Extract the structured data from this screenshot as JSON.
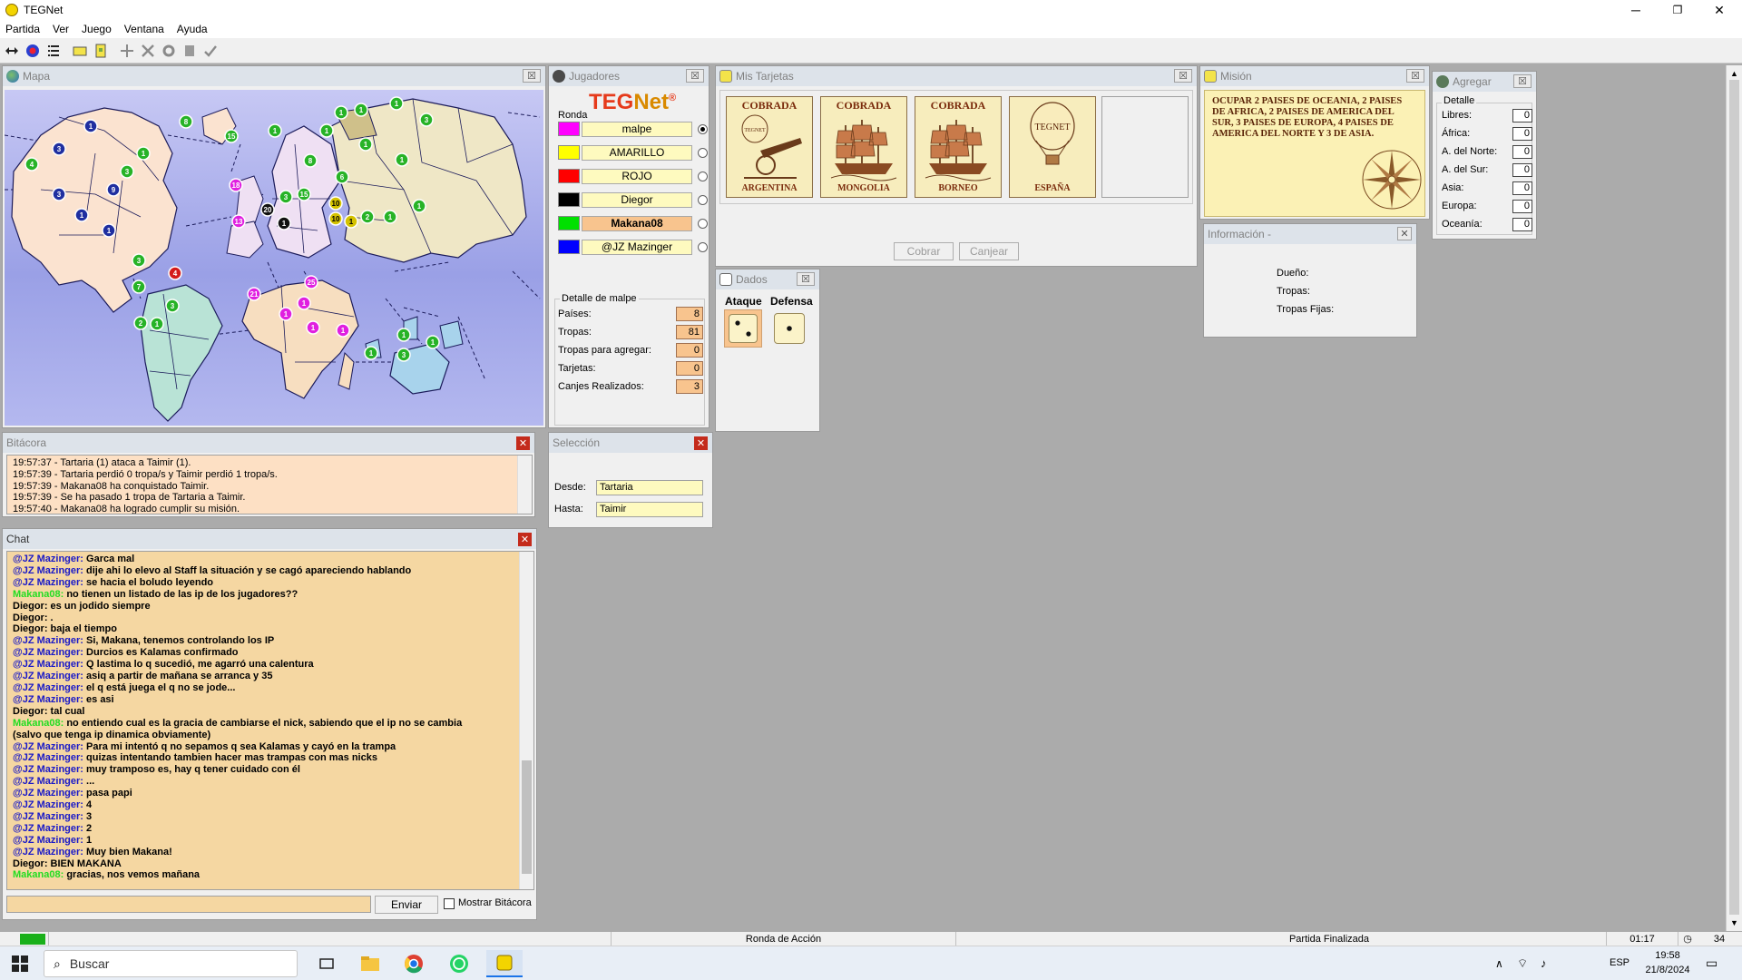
{
  "window": {
    "title": "TEGNet",
    "minimize": "─",
    "maximize": "❐",
    "close": "✕"
  },
  "menu": [
    "Partida",
    "Ver",
    "Juego",
    "Ventana",
    "Ayuda"
  ],
  "map": {
    "title": "Mapa",
    "troops": [
      {
        "n": "1",
        "c": "#1f2fa0"
      },
      {
        "n": "3",
        "c": "#1f2fa0"
      },
      {
        "n": "4",
        "c": "#27b327"
      },
      {
        "n": "3",
        "c": "#1f2fa0"
      },
      {
        "n": "9",
        "c": "#1f2fa0"
      },
      {
        "n": "1",
        "c": "#1f2fa0"
      },
      {
        "n": "1",
        "c": "#1f2fa0"
      },
      {
        "n": "3",
        "c": "#27b327"
      },
      {
        "n": "1",
        "c": "#27b327"
      },
      {
        "n": "8",
        "c": "#27b327"
      },
      {
        "n": "15",
        "c": "#27b327"
      },
      {
        "n": "1",
        "c": "#27b327"
      },
      {
        "n": "18",
        "c": "#e020e0"
      },
      {
        "n": "20",
        "c": "#111111"
      },
      {
        "n": "13",
        "c": "#e020e0"
      },
      {
        "n": "1",
        "c": "#111111"
      },
      {
        "n": "3",
        "c": "#27b327"
      },
      {
        "n": "15",
        "c": "#27b327"
      },
      {
        "n": "8",
        "c": "#27b327"
      },
      {
        "n": "10",
        "c": "#d4c200"
      },
      {
        "n": "10",
        "c": "#d4c200"
      },
      {
        "n": "1",
        "c": "#d4c200"
      },
      {
        "n": "1",
        "c": "#27b327"
      },
      {
        "n": "1",
        "c": "#27b327"
      },
      {
        "n": "1",
        "c": "#27b327"
      },
      {
        "n": "6",
        "c": "#27b327"
      },
      {
        "n": "1",
        "c": "#27b327"
      },
      {
        "n": "1",
        "c": "#27b327"
      },
      {
        "n": "1",
        "c": "#27b327"
      },
      {
        "n": "2",
        "c": "#27b327"
      },
      {
        "n": "1",
        "c": "#27b327"
      },
      {
        "n": "1",
        "c": "#27b327"
      },
      {
        "n": "3",
        "c": "#27b327"
      },
      {
        "n": "1",
        "c": "#27b327"
      },
      {
        "n": "3",
        "c": "#27b327"
      },
      {
        "n": "4",
        "c": "#d41a1a"
      },
      {
        "n": "7",
        "c": "#27b327"
      },
      {
        "n": "3",
        "c": "#27b327"
      },
      {
        "n": "2",
        "c": "#27b327"
      },
      {
        "n": "1",
        "c": "#27b327"
      },
      {
        "n": "21",
        "c": "#e020e0"
      },
      {
        "n": "25",
        "c": "#e020e0"
      },
      {
        "n": "1",
        "c": "#e020e0"
      },
      {
        "n": "1",
        "c": "#e020e0"
      },
      {
        "n": "1",
        "c": "#e020e0"
      },
      {
        "n": "1",
        "c": "#e020e0"
      },
      {
        "n": "1",
        "c": "#27b327"
      },
      {
        "n": "3",
        "c": "#27b327"
      },
      {
        "n": "1",
        "c": "#27b327"
      },
      {
        "n": "1",
        "c": "#27b327"
      }
    ]
  },
  "players": {
    "title": "Jugadores",
    "logo_a": "TEG",
    "logo_b": "Net",
    "logo_mark": "®",
    "round_label": "Ronda",
    "list": [
      {
        "name": "malpe",
        "color": "#ff00ff",
        "selected": true,
        "bold": false
      },
      {
        "name": "AMARILLO",
        "color": "#ffff00",
        "selected": false,
        "bold": false
      },
      {
        "name": "ROJO",
        "color": "#ff0000",
        "selected": false,
        "bold": false
      },
      {
        "name": "Diegor",
        "color": "#000000",
        "selected": false,
        "bold": false
      },
      {
        "name": "Makana08",
        "color": "#00e000",
        "selected": false,
        "bold": true
      },
      {
        "name": "@JZ Mazinger",
        "color": "#0000ff",
        "selected": false,
        "bold": false
      }
    ],
    "detail_title": "Detalle de malpe",
    "detail": [
      {
        "label": "Países:",
        "value": "8"
      },
      {
        "label": "Tropas:",
        "value": "81"
      },
      {
        "label": "Tropas para agregar:",
        "value": "0"
      },
      {
        "label": "Tarjetas:",
        "value": "0"
      },
      {
        "label": "Canjes Realizados:",
        "value": "3"
      }
    ]
  },
  "cards": {
    "title": "Mis Tarjetas",
    "items": [
      {
        "status": "COBRADA",
        "country": "ARGENTINA",
        "symbol": "cannon"
      },
      {
        "status": "COBRADA",
        "country": "MONGOLIA",
        "symbol": "ship"
      },
      {
        "status": "COBRADA",
        "country": "BORNEO",
        "symbol": "ship"
      },
      {
        "status": "",
        "country": "ESPAÑA",
        "symbol": "balloon"
      }
    ],
    "balloon_logo": "TEGNET",
    "cannon_logo": "TEGNET",
    "btn_cobrar": "Cobrar",
    "btn_canjear": "Canjear"
  },
  "mission": {
    "title": "Misión",
    "text": "OCUPAR 2 PAISES DE OCEANIA, 2 PAISES DE AFRICA, 2 PAISES DE AMERICA DEL SUR, 3 PAISES DE EUROPA, 4 PAISES DE AMERICA DEL NORTE Y 3 DE ASIA."
  },
  "agregar": {
    "title": "Agregar",
    "detail_label": "Detalle",
    "rows": [
      {
        "label": "Libres:",
        "value": "0"
      },
      {
        "label": "África:",
        "value": "0"
      },
      {
        "label": "A. del Norte:",
        "value": "0"
      },
      {
        "label": "A. del Sur:",
        "value": "0"
      },
      {
        "label": "Asia:",
        "value": "0"
      },
      {
        "label": "Europa:",
        "value": "0"
      },
      {
        "label": "Oceanía:",
        "value": "0"
      }
    ]
  },
  "info": {
    "title": "Información -",
    "owner": "Dueño:",
    "troops": "Tropas:",
    "fixed": "Tropas Fijas:"
  },
  "dice": {
    "title": "Dados",
    "attack": "Ataque",
    "defense": "Defensa",
    "attack_value": 2,
    "defense_value": 1
  },
  "selection": {
    "title": "Selección",
    "from_label": "Desde:",
    "from": "Tartaria",
    "to_label": "Hasta:",
    "to": "Taimir"
  },
  "log": {
    "title": "Bitácora",
    "lines": [
      "19:57:37 - Tartaria (1) ataca a Taimir (1).",
      "19:57:39 - Tartaria perdió 0 tropa/s y Taimir perdió 1 tropa/s.",
      "19:57:39 - Makana08 ha conquistado Taimir.",
      "19:57:39 - Se ha pasado 1 tropa de Tartaria a Taimir.",
      "19:57:40 - Makana08 ha logrado cumplir su misión."
    ]
  },
  "chat": {
    "title": "Chat",
    "send": "Enviar",
    "show_log": "Mostrar Bitácora",
    "lines": [
      {
        "who": "@JZ Mazinger:",
        "c": "#1a1ac8",
        "msg": " Garca mal"
      },
      {
        "who": "@JZ Mazinger:",
        "c": "#1a1ac8",
        "msg": " dije ahi lo elevo al Staff la situación y se cagó apareciendo hablando"
      },
      {
        "who": "@JZ Mazinger:",
        "c": "#1a1ac8",
        "msg": " se hacia el boludo leyendo"
      },
      {
        "who": "Makana08:",
        "c": "#22dd22",
        "msg": " no tienen un listado de las ip de los jugadores??"
      },
      {
        "who": "Diegor:",
        "c": "#000000",
        "msg": " es un jodido siempre"
      },
      {
        "who": "Diegor:",
        "c": "#000000",
        "msg": " ."
      },
      {
        "who": "Diegor:",
        "c": "#000000",
        "msg": " baja el tiempo"
      },
      {
        "who": "@JZ Mazinger:",
        "c": "#1a1ac8",
        "msg": " Si, Makana, tenemos controlando los IP"
      },
      {
        "who": "@JZ Mazinger:",
        "c": "#1a1ac8",
        "msg": " Durcios es Kalamas confirmado"
      },
      {
        "who": "@JZ Mazinger:",
        "c": "#1a1ac8",
        "msg": " Q lastima lo q sucedió, me agarró una calentura"
      },
      {
        "who": "@JZ Mazinger:",
        "c": "#1a1ac8",
        "msg": " asiq a partir de mañana se arranca y 35"
      },
      {
        "who": "@JZ Mazinger:",
        "c": "#1a1ac8",
        "msg": " el q está juega el q no se jode..."
      },
      {
        "who": "@JZ Mazinger:",
        "c": "#1a1ac8",
        "msg": " es asi"
      },
      {
        "who": "Diegor:",
        "c": "#000000",
        "msg": " tal cual"
      },
      {
        "who": "Makana08:",
        "c": "#22dd22",
        "msg": " no entiendo cual es la gracia de cambiarse el nick, sabiendo que el ip no se cambia"
      },
      {
        "who": "",
        "c": "#000000",
        "msg": "(salvo que tenga ip dinamica obviamente)"
      },
      {
        "who": "@JZ Mazinger:",
        "c": "#1a1ac8",
        "msg": " Para mi intentó q no sepamos q sea Kalamas y cayó en la trampa"
      },
      {
        "who": "@JZ Mazinger:",
        "c": "#1a1ac8",
        "msg": " quizas intentando tambien hacer mas trampas con mas nicks"
      },
      {
        "who": "@JZ Mazinger:",
        "c": "#1a1ac8",
        "msg": " muy tramposo es, hay q tener cuidado con él"
      },
      {
        "who": "@JZ Mazinger:",
        "c": "#1a1ac8",
        "msg": " ..."
      },
      {
        "who": "@JZ Mazinger:",
        "c": "#1a1ac8",
        "msg": " pasa papi"
      },
      {
        "who": "@JZ Mazinger:",
        "c": "#1a1ac8",
        "msg": " 4"
      },
      {
        "who": "@JZ Mazinger:",
        "c": "#1a1ac8",
        "msg": " 3"
      },
      {
        "who": "@JZ Mazinger:",
        "c": "#1a1ac8",
        "msg": " 2"
      },
      {
        "who": "@JZ Mazinger:",
        "c": "#1a1ac8",
        "msg": " 1"
      },
      {
        "who": "@JZ Mazinger:",
        "c": "#1a1ac8",
        "msg": " Muy bien Makana!"
      },
      {
        "who": "Diegor:",
        "c": "#000000",
        "msg": " BIEN MAKANA"
      },
      {
        "who": "Makana08:",
        "c": "#22dd22",
        "msg": " gracias, nos vemos mañana"
      }
    ]
  },
  "status": {
    "phase": "Ronda de Acción",
    "state": "Partida Finalizada",
    "timer": "01:17",
    "count": "34"
  },
  "taskbar": {
    "search": "Buscar",
    "lang": "ESP",
    "time": "19:58",
    "date": "21/8/2024"
  }
}
